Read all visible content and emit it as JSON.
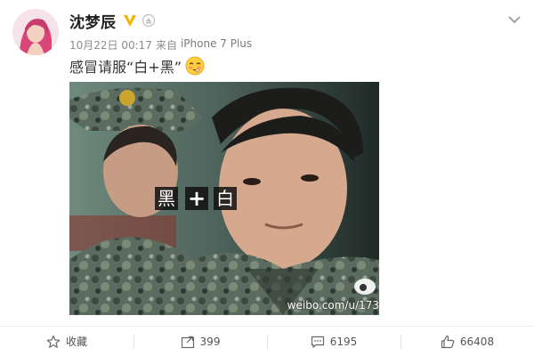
{
  "post": {
    "author": "沈梦辰",
    "date": "10月22日 00:17",
    "source_prefix": "来自",
    "device": "iPhone 7 Plus",
    "text": "感冒请服“白+黑”",
    "image_overlay_text": "黑",
    "image_overlay_text2": "白",
    "watermark": "weibo.com/u/173"
  },
  "actions": {
    "favorite_label": "收藏",
    "repost_count": "399",
    "comment_count": "6195",
    "like_count": "66408"
  },
  "colors": {
    "vip_badge": "#f4b400",
    "link_gray": "#8c8c8c",
    "divider": "#ededed"
  },
  "icons": [
    "star-icon",
    "repost-icon",
    "comment-icon",
    "thumbs-up-icon",
    "chevron-down-icon",
    "vip-badge-icon",
    "medal-icon",
    "shy-emoji-icon"
  ]
}
